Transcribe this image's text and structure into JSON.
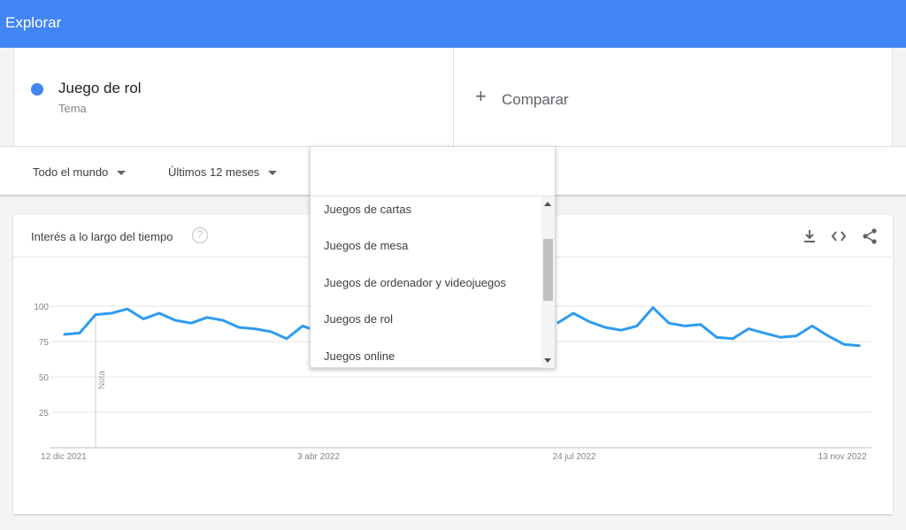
{
  "header": {
    "title": "Explorar"
  },
  "term": {
    "name": "Juego de rol",
    "type": "Tema",
    "color": "#4285f4"
  },
  "compare": {
    "plus": "+",
    "label": "Comparar"
  },
  "filters": {
    "region": "Todo el mundo",
    "time_range": "Últimos 12 meses"
  },
  "chart_card": {
    "title": "Interés a lo largo del tiempo",
    "help": "?"
  },
  "dropdown": {
    "search_value": "",
    "options": [
      "Juegos de cartas",
      "Juegos de mesa",
      "Juegos de ordenador y videojuegos",
      "Juegos de rol",
      "Juegos online"
    ]
  },
  "chart_data": {
    "type": "line",
    "title": "",
    "xlabel": "",
    "ylabel": "",
    "ylim": [
      0,
      100
    ],
    "y_ticks": [
      "100",
      "75",
      "50",
      "25"
    ],
    "x_ticks": [
      "12 dic 2021",
      "3 abr 2022",
      "24 jul 2022",
      "13 nov 2022"
    ],
    "annotation": "Nota",
    "grid": true,
    "color": "#2e9bf0",
    "series": [
      {
        "values": [
          80,
          81,
          94,
          95,
          98,
          91,
          95,
          90,
          88,
          92,
          90,
          85,
          84,
          82,
          77,
          86,
          82,
          null,
          null,
          null,
          null,
          null,
          null,
          null,
          null,
          null,
          null,
          null,
          null,
          null,
          null,
          88,
          95,
          89,
          85,
          83,
          86,
          99,
          88,
          86,
          87,
          78,
          77,
          84,
          81,
          78,
          79,
          86,
          79,
          73,
          72
        ]
      }
    ]
  }
}
